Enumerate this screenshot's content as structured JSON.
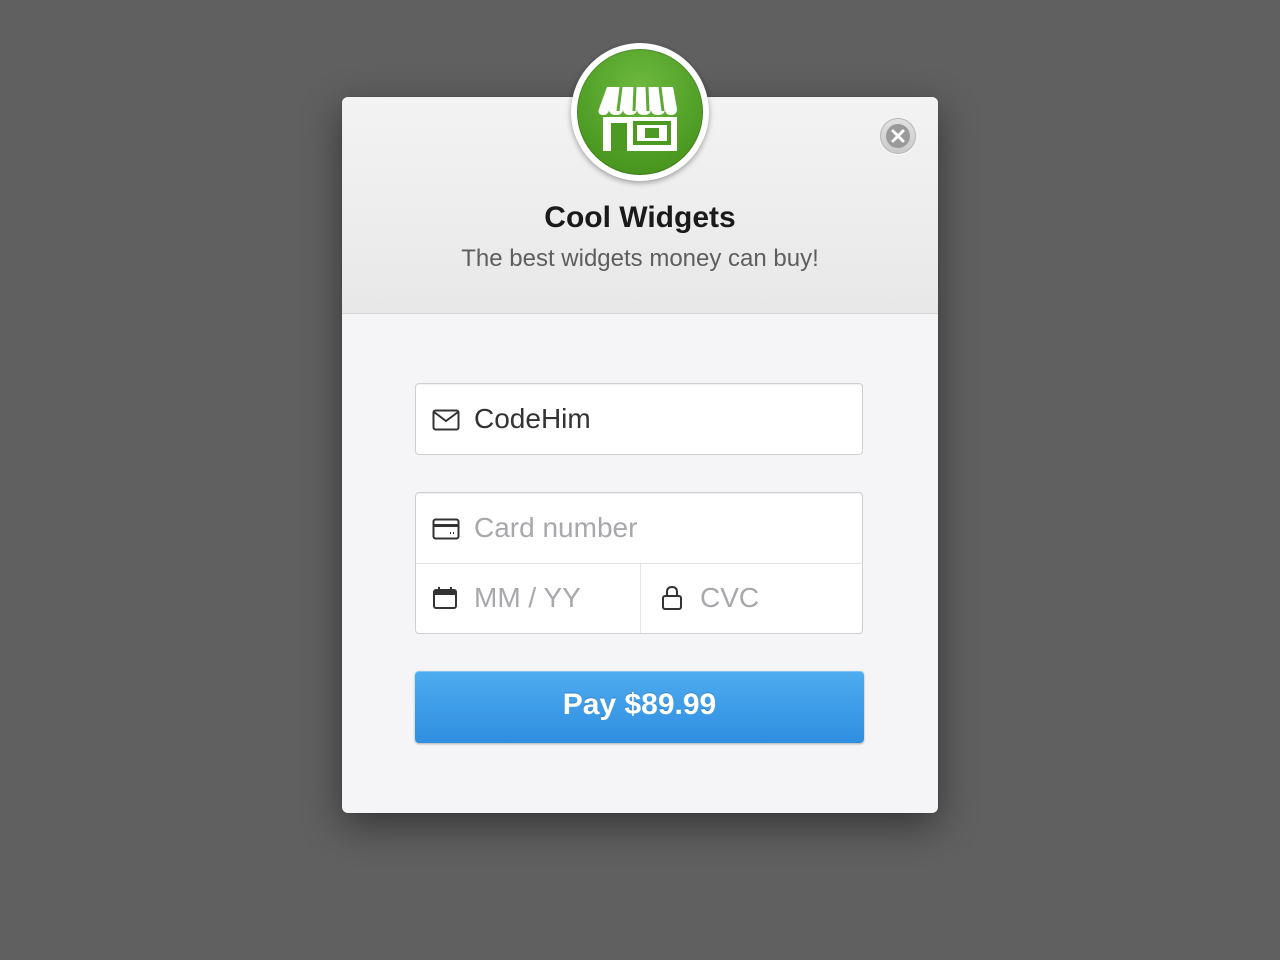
{
  "store": {
    "name": "Cool Widgets",
    "tagline": "The best widgets money can buy!",
    "logo_icon": "storefront-icon",
    "brand_color": "#55a52b"
  },
  "form": {
    "email": {
      "value": "CodeHim",
      "icon": "envelope-icon"
    },
    "card_number": {
      "placeholder": "Card number",
      "icon": "credit-card-icon"
    },
    "expiry": {
      "placeholder": "MM / YY",
      "icon": "calendar-icon"
    },
    "cvc": {
      "placeholder": "CVC",
      "icon": "lock-icon"
    }
  },
  "pay_button": {
    "label": "Pay $89.99",
    "color": "#3a9be6"
  },
  "close_icon": "close-icon"
}
